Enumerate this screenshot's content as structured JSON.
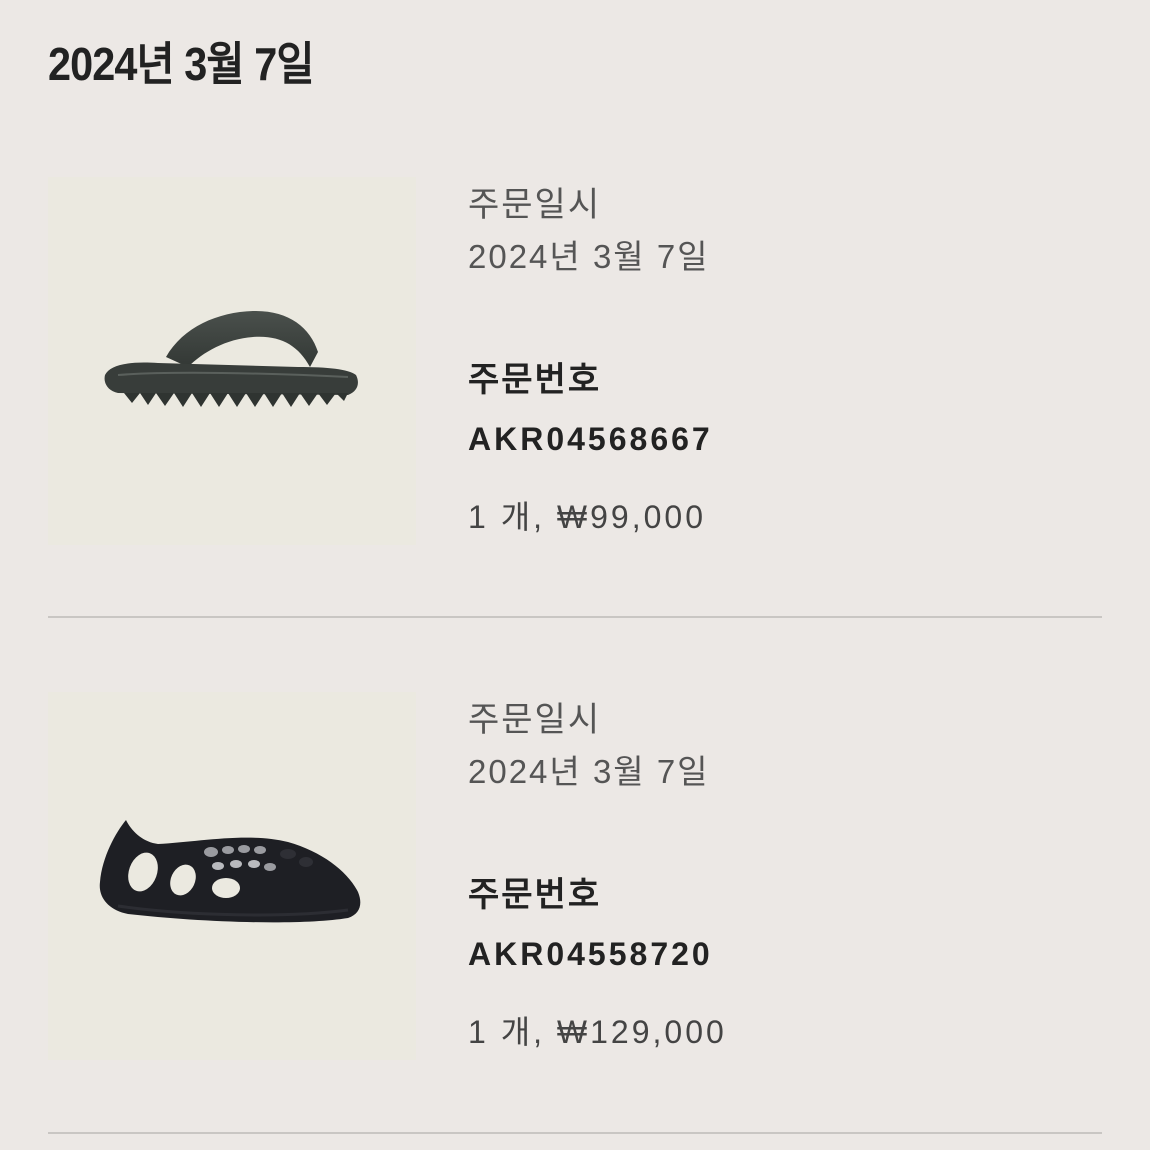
{
  "page_title": "2024년 3월 7일",
  "orders": [
    {
      "product_icon": "slide-sandal-image",
      "date_label": "주문일시",
      "date_value": "2024년 3월 7일",
      "order_no_label": "주문번호",
      "order_no_value": "AKR04568667",
      "qty_price": "1 개, ₩99,000"
    },
    {
      "product_icon": "foam-runner-shoe-image",
      "date_label": "주문일시",
      "date_value": "2024년 3월 7일",
      "order_no_label": "주문번호",
      "order_no_value": "AKR04558720",
      "qty_price": "1 개, ₩129,000"
    }
  ],
  "colors": {
    "background": "#ece8e5",
    "image_background": "#ebe9e0",
    "divider": "#c9c6c3",
    "slide_color": "#3d423f",
    "shoe_color": "#1d1e22"
  }
}
